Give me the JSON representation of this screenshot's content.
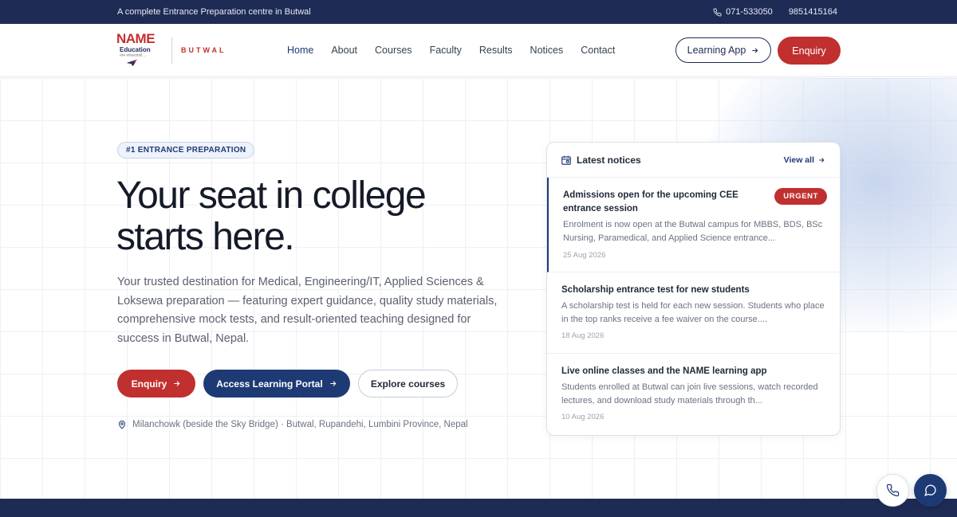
{
  "topbar": {
    "tagline": "A complete Entrance Preparation centre in Butwal",
    "phone_primary": "071-533050",
    "phone_secondary": "9851415164"
  },
  "header": {
    "logo_mark": "NAME",
    "logo_sub": "Education",
    "logo_motto": "नाम सफलताको...",
    "branch": "BUTWAL",
    "nav": [
      "Home",
      "About",
      "Courses",
      "Faculty",
      "Results",
      "Notices",
      "Contact"
    ],
    "learning_app_label": "Learning App",
    "enquiry_label": "Enquiry"
  },
  "hero": {
    "badge": "#1 ENTRANCE PREPARATION",
    "headline_line1": "Your seat in college",
    "headline_line2": "starts here.",
    "subtext": "Your trusted destination for Medical, Engineering/IT, Applied Sciences & Loksewa preparation — featuring expert guidance, quality study materials, comprehensive mock tests, and result-oriented teaching designed for success in Butwal, Nepal.",
    "cta_enquiry": "Enquiry",
    "cta_portal": "Access Learning Portal",
    "cta_explore": "Explore courses",
    "location": "Milanchowk (beside the Sky Bridge) · Butwal, Rupandehi, Lumbini Province, Nepal"
  },
  "notices": {
    "title": "Latest notices",
    "view_all": "View all",
    "items": [
      {
        "title": "Admissions open for the upcoming CEE entrance session",
        "badge": "URGENT",
        "body": "Enrolment is now open at the Butwal campus for MBBS, BDS, BSc Nursing, Paramedical, and Applied Science entrance...",
        "date": "25 Aug 2026"
      },
      {
        "title": "Scholarship entrance test for new students",
        "body": "A scholarship test is held for each new session. Students who place in the top ranks receive a fee waiver on the course....",
        "date": "18 Aug 2026"
      },
      {
        "title": "Live online classes and the NAME learning app",
        "body": "Students enrolled at Butwal can join live sessions, watch recorded lectures, and download study materials through th...",
        "date": "10 Aug 2026"
      }
    ]
  },
  "colors": {
    "navy": "#1e2c55",
    "brand_blue": "#1e3a75",
    "brand_red": "#c0302f"
  },
  "icons": {
    "phone": "phone-icon",
    "arrow": "arrow-right-icon",
    "location": "map-pin-icon",
    "calendar": "calendar-icon",
    "chat": "chat-bubble-icon"
  }
}
